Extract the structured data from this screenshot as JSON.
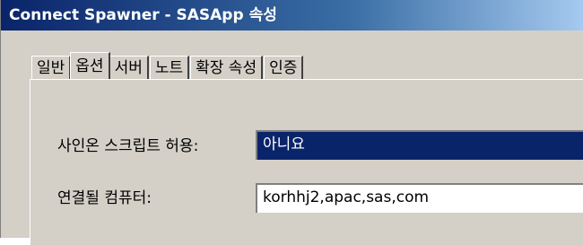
{
  "window": {
    "title": "Connect Spawner - SASApp 속성"
  },
  "tabs": [
    {
      "label": "일반"
    },
    {
      "label": "옵션",
      "active": true
    },
    {
      "label": "서버"
    },
    {
      "label": "노트"
    },
    {
      "label": "확장 속성"
    },
    {
      "label": "인증"
    }
  ],
  "form": {
    "signon_label": "사인온 스크립트 허용:",
    "signon_value": "아니요",
    "host_label": "연결될 컴퓨터:",
    "host_value": "korhhj2,apac,sas,com"
  },
  "colors": {
    "titlebar": "#0a246a",
    "dialog": "#d4d0c8",
    "selection": "#0a246a"
  }
}
